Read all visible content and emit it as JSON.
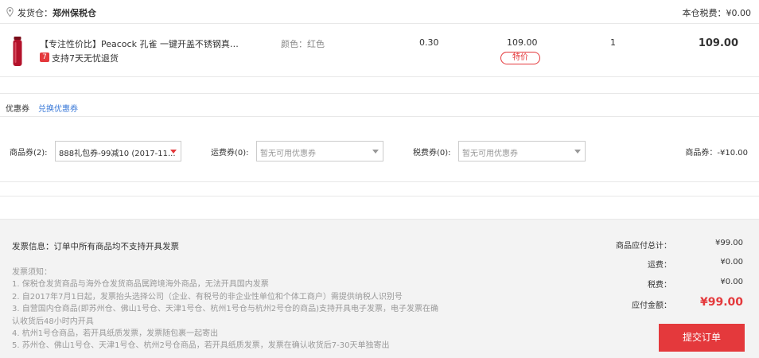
{
  "warehouse": {
    "label": "发货仓：",
    "name": "郑州保税仓",
    "tax_label": "本仓税费：",
    "tax_value": "¥0.00"
  },
  "product": {
    "title": "【专注性价比】Peacock 孔雀 一键开盖不锈钢真…",
    "return_badge": "7",
    "return_text": "支持7天无忧退货",
    "color": "颜色：红色",
    "weight": "0.30",
    "price": "109.00",
    "price_tag": "特价",
    "quantity": "1",
    "subtotal": "109.00"
  },
  "coupon": {
    "title": "优惠券",
    "exchange_link": "兑换优惠券",
    "goods_label": "商品券(2):",
    "goods_value": "888礼包券-99减10 (2017-11...",
    "shipping_label": "运费券(0):",
    "shipping_value": "暂无可用优惠券",
    "tax_label": "税费券(0):",
    "tax_value": "暂无可用优惠券",
    "discount": "商品券：-¥10.00"
  },
  "invoice": {
    "title": "发票信息：订单中所有商品均不支持开具发票",
    "notes_heading": "发票须知：",
    "notes": [
      "1. 保税仓发货商品与海外仓发货商品属跨境海外商品，无法开具国内发票",
      "2. 自2017年7月1日起，发票抬头选择公司（企业、有税号的非企业性单位和个体工商户）需提供纳税人识别号",
      "3. 自营国内仓商品(即苏州仓、佛山1号仓、天津1号仓、杭州1号仓与杭州2号仓的商品)支持开具电子发票，电子发票在确",
      "认收货后48小时内开具",
      "4. 杭州1号仓商品，若开具纸质发票，发票随包裹一起寄出",
      "5. 苏州仓、佛山1号仓、天津1号仓、杭州2号仓商品，若开具纸质发票，发票在确认收货后7-30天单独寄出"
    ]
  },
  "summary": {
    "goods_total_label": "商品应付总计：",
    "goods_total": "¥99.00",
    "shipping_label": "运费：",
    "shipping": "¥0.00",
    "tax_label": "税费：",
    "tax": "¥0.00",
    "payable_label": "应付金额：",
    "payable": "¥99.00"
  },
  "submit_label": "提交订单",
  "colors": {
    "accent": "#e4393c",
    "link": "#3a79d8",
    "footer_bg": "#f3f3f3"
  },
  "icons": [
    "location-pin-icon",
    "product-thumbnail",
    "return-badge-icon",
    "dropdown-arrow-icon"
  ]
}
